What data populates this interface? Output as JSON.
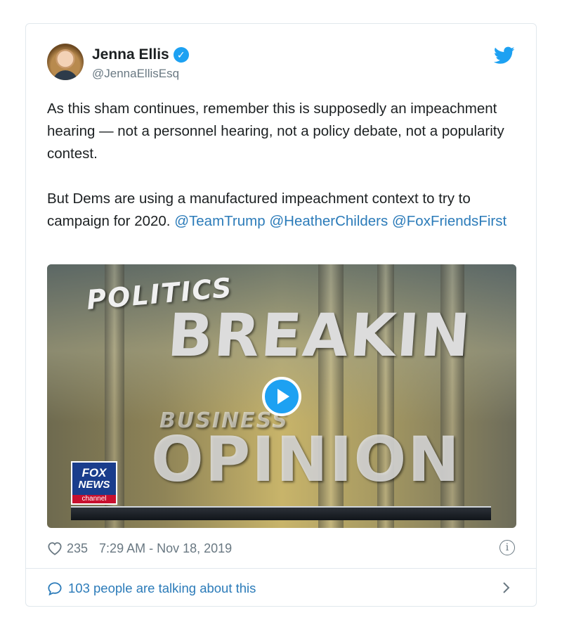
{
  "tweet": {
    "author_name": "Jenna Ellis",
    "handle": "@JennaEllisEsq",
    "paragraph1": "As this sham continues, remember this is supposedly an impeachment hearing — not a personnel hearing, not a policy debate, not a popularity contest.",
    "paragraph2_text": "But Dems are using a manufactured impeachment context to try to campaign for 2020.",
    "mentions": [
      "@TeamTrump",
      "@HeatherChilders",
      "@FoxFriendsFirst"
    ],
    "likes": "235",
    "timestamp": "7:29 AM - Nov 18, 2019",
    "talking": "103 people are talking about this"
  },
  "video": {
    "overlay_politics": "POLITICS",
    "overlay_breaking": "BREAKIN",
    "overlay_business": "BUSINESS",
    "overlay_opinion": "OPINION",
    "logo_line1": "FOX",
    "logo_line2": "NEWS",
    "logo_line3": "channel"
  },
  "icons": {
    "verified": "verified-badge-icon",
    "platform": "twitter-bird-icon",
    "like": "heart-icon",
    "info": "info-icon",
    "play": "play-icon",
    "reply": "speech-bubble-icon",
    "more": "chevron-right-icon"
  },
  "colors": {
    "accent": "#1da1f2",
    "link": "#2b7bb9",
    "muted": "#697882",
    "text": "#1c2022",
    "border": "#e1e8ed"
  }
}
